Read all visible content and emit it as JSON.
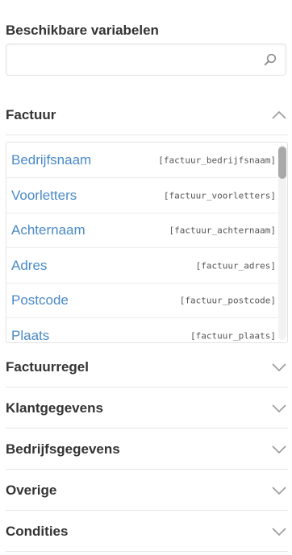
{
  "panel": {
    "title": "Beschikbare variabelen",
    "search_placeholder": ""
  },
  "sections": [
    {
      "label": "Factuur",
      "expanded": true,
      "items": [
        {
          "name": "Bedrijfsnaam",
          "code": "[factuur_bedrijfsnaam]"
        },
        {
          "name": "Voorletters",
          "code": "[factuur_voorletters]"
        },
        {
          "name": "Achternaam",
          "code": "[factuur_achternaam]"
        },
        {
          "name": "Adres",
          "code": "[factuur_adres]"
        },
        {
          "name": "Postcode",
          "code": "[factuur_postcode]"
        },
        {
          "name": "Plaats",
          "code": "[factuur_plaats]"
        }
      ]
    },
    {
      "label": "Factuurregel",
      "expanded": false
    },
    {
      "label": "Klantgegevens",
      "expanded": false
    },
    {
      "label": "Bedrijfsgegevens",
      "expanded": false
    },
    {
      "label": "Overige",
      "expanded": false
    },
    {
      "label": "Condities",
      "expanded": false
    }
  ],
  "colors": {
    "link": "#4a8ac6",
    "text": "#333333",
    "divider": "#e6e6e6",
    "chevron": "#9a9a9a"
  },
  "icons": {
    "search": "search-icon",
    "expanded": "chevron-up-icon",
    "collapsed": "chevron-down-icon"
  }
}
